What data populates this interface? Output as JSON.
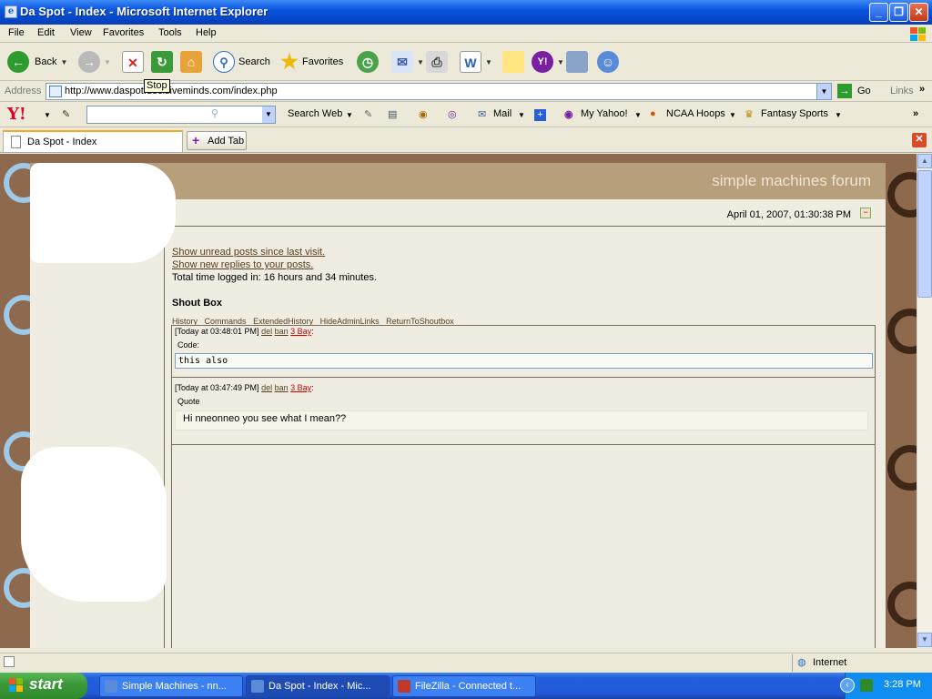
{
  "window": {
    "title": "Da Spot - Index - Microsoft Internet Explorer",
    "minimize_label": "_",
    "restore_label": "❐",
    "close_label": "✕"
  },
  "menu": [
    "File",
    "Edit",
    "View",
    "Favorites",
    "Tools",
    "Help"
  ],
  "toolbar": {
    "back": "Back",
    "search": "Search",
    "favorites": "Favorites",
    "tooltip": "Stop"
  },
  "address": {
    "label": "Address",
    "url": "http://www.daspot.decisiveminds.com/index.php",
    "go": "Go",
    "links": "Links"
  },
  "yahoo": {
    "logo": "Y!",
    "search_web": "Search Web",
    "mail": "Mail",
    "my_yahoo": "My Yahoo!",
    "ncaa": "NCAA Hoops",
    "fantasy": "Fantasy Sports"
  },
  "tabs": {
    "active_tab": "Da Spot - Index",
    "add_tab": "Add Tab"
  },
  "forum": {
    "logo": "simple machines forum",
    "datetime": "April 01, 2007, 01:30:38 PM",
    "link_unread": "Show unread posts since last visit.",
    "link_replies": "Show new replies to your posts.",
    "time_logged": "Total time logged in: 16 hours and 34 minutes.",
    "shoutbox_title": "Shout Box",
    "shout_links": [
      "History",
      "Commands",
      "ExtendedHistory",
      "HideAdminLinks",
      "ReturnToShoutbox"
    ],
    "shouts": [
      {
        "time": "[Today at 03:48:01 PM]",
        "del": "del",
        "ban": "ban",
        "user": "3 Bay",
        "type_label": "Code:",
        "body": "this also"
      },
      {
        "time": "[Today at 03:47:49 PM]",
        "del": "del",
        "ban": "ban",
        "user": "3 Bay",
        "type_label": "Quote",
        "body": "Hi nneonneo you see what I mean??"
      }
    ]
  },
  "status": {
    "zone": "Internet"
  },
  "taskbar": {
    "start": "start",
    "tasks": [
      "Simple Machines - nn...",
      "Da Spot - Index - Mic...",
      "FileZilla - Connected t..."
    ],
    "clock": "3:28 PM"
  }
}
